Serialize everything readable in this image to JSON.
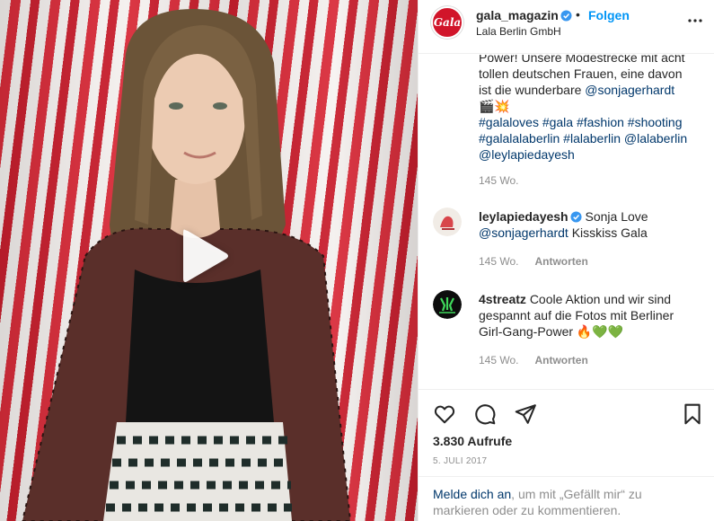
{
  "post": {
    "username": "gala_magazin",
    "dot": "•",
    "follow_label": "Folgen",
    "location": "Lala Berlin GmbH",
    "avatar_text": "Gala",
    "caption_lines": [
      "Power! Unsere Modestrecke mit acht",
      "tollen deutschen Frauen, eine davon",
      "ist die wunderbare"
    ],
    "caption_mention": "@sonjagerhardt",
    "caption_emoji": "🎬💥",
    "caption_tags_line1": "#galaloves #gala #fashion #shooting",
    "caption_tags_line2": "#galalalaberlin #lalaberlin @lalaberlin",
    "caption_tags_line3": "@leylapiedayesh",
    "caption_time": "145 Wo."
  },
  "comments": [
    {
      "user": "leylapiedayesh",
      "verified": true,
      "text_line1": "Sonja Love",
      "mention": "@sonjagerhardt",
      "text_line2": "Kisskiss Gala",
      "time": "145 Wo.",
      "reply_label": "Antworten"
    },
    {
      "user": "4streatz",
      "verified": false,
      "text_line1": "Coole Aktion und wir sind",
      "text_line2": "gespannt auf die Fotos mit Berliner",
      "text_line3": "Girl-Gang-Power 🔥💚💚",
      "time": "145 Wo.",
      "reply_label": "Antworten"
    }
  ],
  "stats": {
    "views": "3.830 Aufrufe",
    "date": "5. JULI 2017"
  },
  "login_prompt": {
    "link": "Melde dich an",
    "rest_line1": ", um mit „Gefällt mir“ zu",
    "rest_line2": "markieren oder zu kommentieren."
  },
  "icons": {
    "verified": "verified-badge-icon",
    "more": "more-options-icon",
    "like": "heart-icon",
    "comment": "comment-bubble-icon",
    "share": "paper-plane-icon",
    "save": "bookmark-icon",
    "play": "play-icon"
  },
  "colors": {
    "follow_blue": "#0095f6",
    "link_blue": "#00376b",
    "meta_gray": "#8e8e8e",
    "gala_red": "#d1152a",
    "verified_blue": "#3897f0"
  }
}
